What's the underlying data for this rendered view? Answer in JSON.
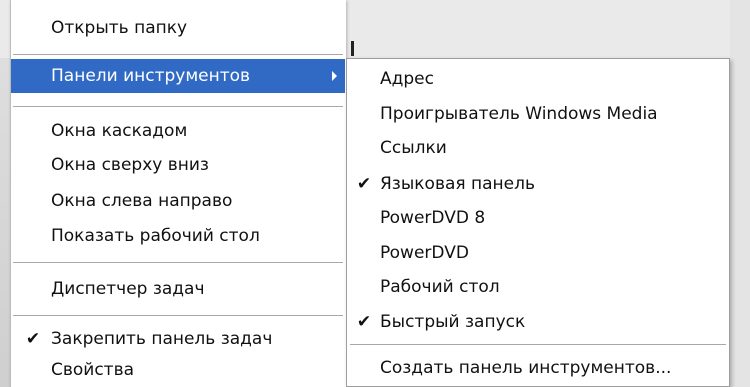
{
  "context_menu": {
    "items": [
      {
        "label": "Открыть папку"
      },
      {
        "label": "Панели инструментов"
      },
      {
        "label": "Окна каскадом"
      },
      {
        "label": "Окна сверху вниз"
      },
      {
        "label": "Окна слева направо"
      },
      {
        "label": "Показать рабочий стол"
      },
      {
        "label": "Диспетчер задач"
      },
      {
        "label": "Закрепить панель задач",
        "checked": true
      },
      {
        "label": "Свойства"
      }
    ],
    "selected_item": "Панели инструментов"
  },
  "toolbars_submenu": {
    "items": [
      {
        "label": "Адрес"
      },
      {
        "label": "Проигрыватель Windows Media"
      },
      {
        "label": "Ссылки"
      },
      {
        "label": "Языковая панель",
        "checked": true
      },
      {
        "label": "PowerDVD 8"
      },
      {
        "label": "PowerDVD"
      },
      {
        "label": "Рабочий стол"
      },
      {
        "label": "Быстрый запуск",
        "checked": true
      },
      {
        "label": "Создать панель инструментов..."
      }
    ]
  },
  "icons": {
    "checkmark": "✔",
    "submenu_arrow": "chevron-right-icon"
  },
  "colors": {
    "selection_bg": "#316ac5",
    "selection_text": "#ffffff",
    "menu_bg": "#ffffff"
  }
}
